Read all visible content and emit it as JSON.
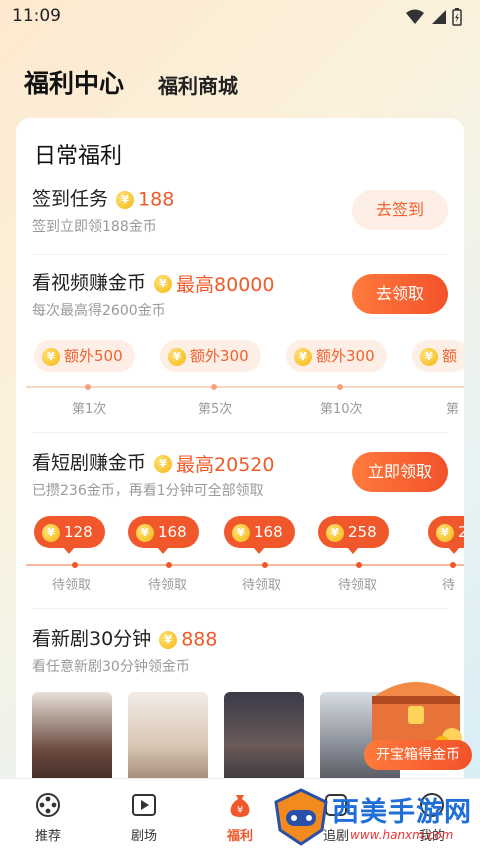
{
  "status_bar": {
    "time": "11:09"
  },
  "header": {
    "tabs": [
      {
        "label": "福利中心",
        "active": true
      },
      {
        "label": "福利商城",
        "active": false
      }
    ]
  },
  "daily": {
    "title": "日常福利",
    "coin_symbol": "¥",
    "signin": {
      "title": "签到任务",
      "reward": "188",
      "subtitle": "签到立即领188金币",
      "button": "去签到"
    },
    "video": {
      "title": "看视频赚金币",
      "reward": "最高80000",
      "subtitle": "每次最高得2600金币",
      "button": "去领取",
      "bonuses": [
        "额外500",
        "额外300",
        "额外300",
        "额"
      ],
      "steps": [
        "第1次",
        "第5次",
        "第10次",
        "第"
      ]
    },
    "drama": {
      "title": "看短剧赚金币",
      "reward": "最高20520",
      "subtitle": "已攒236金币，再看1分钟可全部领取",
      "button": "立即领取",
      "amounts": [
        "128",
        "168",
        "168",
        "258",
        "2"
      ],
      "status": [
        "待领取",
        "待领取",
        "待领取",
        "待领取",
        "待"
      ]
    },
    "new_drama": {
      "title": "看新剧30分钟",
      "reward": "888",
      "subtitle": "看任意新剧30分钟领金币"
    }
  },
  "chest": {
    "button": "开宝箱得金币"
  },
  "bottom_nav": [
    {
      "label": "推荐",
      "icon": "film-reel-icon",
      "active": false
    },
    {
      "label": "剧场",
      "icon": "play-screen-icon",
      "active": false
    },
    {
      "label": "福利",
      "icon": "money-bag-icon",
      "active": true
    },
    {
      "label": "追剧",
      "icon": "follow-icon",
      "active": false
    },
    {
      "label": "我的",
      "icon": "profile-icon",
      "active": false
    }
  ],
  "watermark": {
    "text": "西美手游网",
    "url": "www.hanxm.com"
  },
  "colors": {
    "accent": "#f0572a",
    "accent_light": "#fdeee6",
    "coin": "#f5b60f"
  }
}
